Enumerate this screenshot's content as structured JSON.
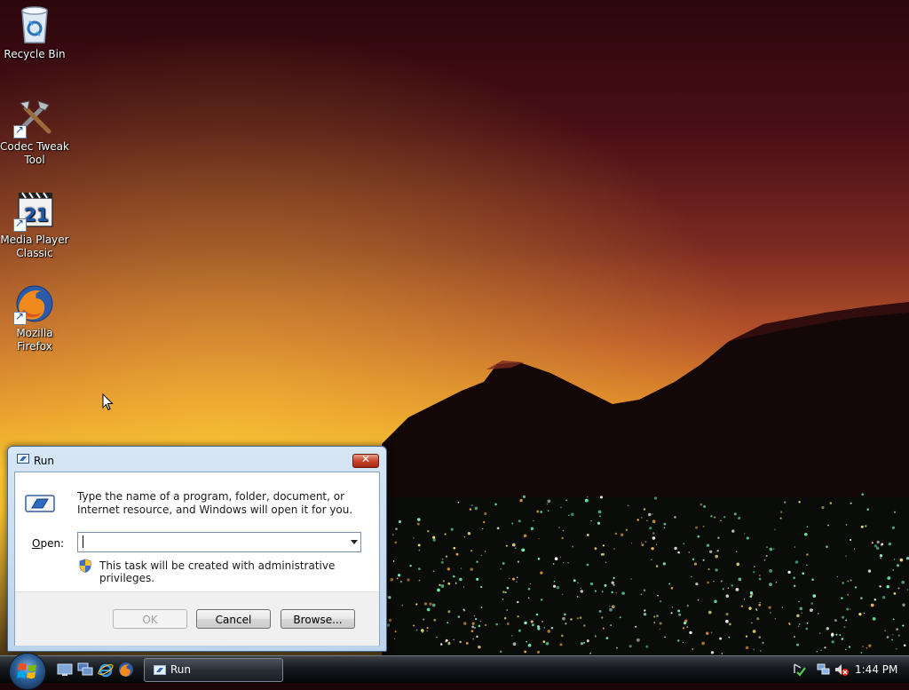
{
  "desktop": {
    "icons": [
      {
        "label": "Recycle Bin",
        "icon": "recycle-bin-icon"
      },
      {
        "label": "Codec Tweak\nTool",
        "icon": "tools-icon"
      },
      {
        "label": "Media Player\nClassic",
        "icon": "media-player-icon"
      },
      {
        "label": "Mozilla\nFirefox",
        "icon": "firefox-icon"
      }
    ]
  },
  "run_dialog": {
    "title": "Run",
    "close_label": "✕",
    "description": "Type the name of a program, folder, document, or Internet resource, and Windows will open it for you.",
    "open_label_prefix": "",
    "open_label_underlined": "O",
    "open_label_suffix": "pen:",
    "open_value": "",
    "admin_note": "This task will be created with administrative privileges.",
    "buttons": {
      "ok": "OK",
      "cancel": "Cancel",
      "browse": "Browse..."
    }
  },
  "taskbar": {
    "task_run_label": "Run",
    "clock": "1:44 PM",
    "quick_launch": [
      "show-desktop-icon",
      "switch-windows-icon",
      "internet-explorer-icon",
      "firefox-icon"
    ],
    "tray": [
      "network-check-icon",
      "network-icon",
      "volume-muted-icon"
    ]
  },
  "colors": {
    "titlebar": "#c8dcf0",
    "taskbar": "#15181d",
    "close_button": "#c7452c"
  }
}
